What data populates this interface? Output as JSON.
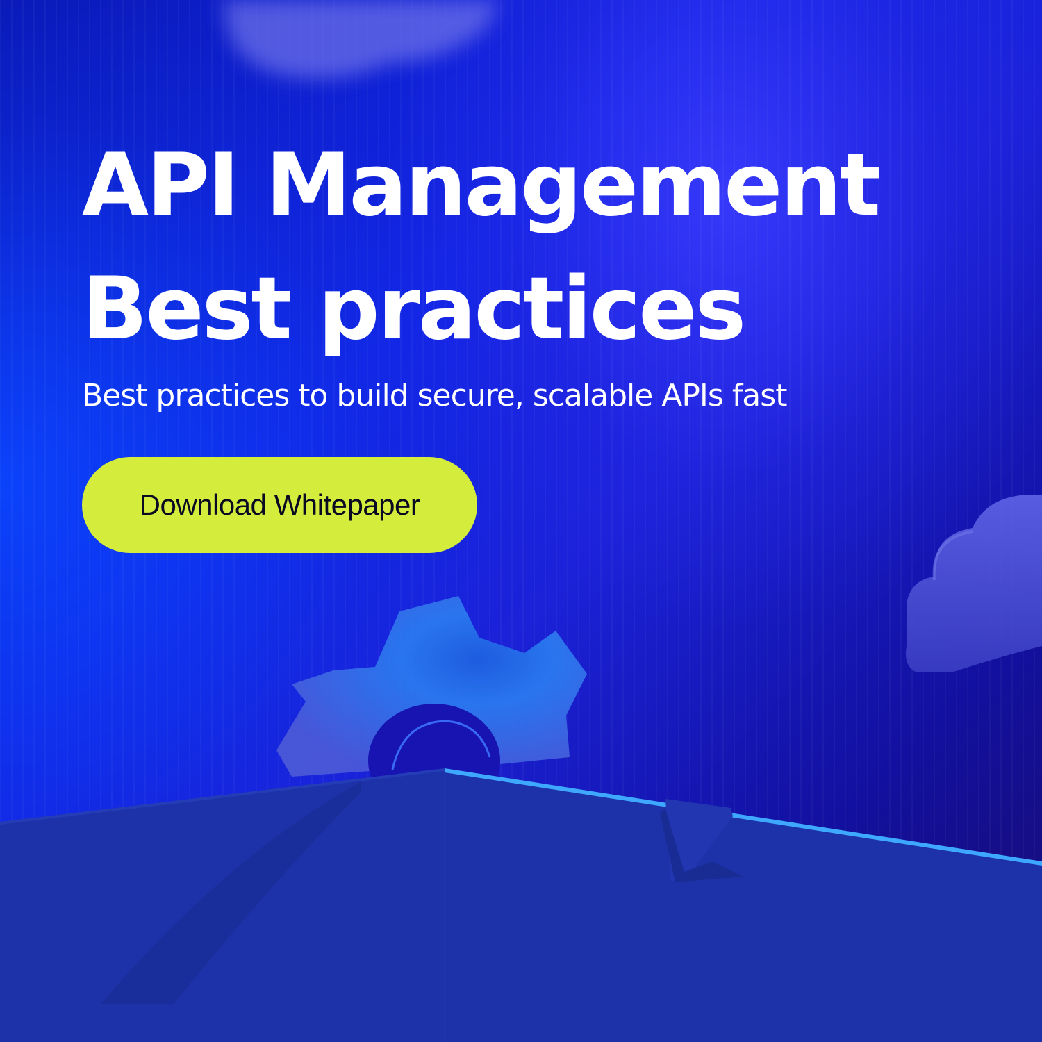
{
  "banner": {
    "headline_line1": "API Management",
    "headline_line2": "Best practices",
    "subtitle": "Best practices to build secure, scalable APIs fast",
    "cta_label": "Download Whitepaper"
  },
  "decorations": {
    "gear": "gear-icon",
    "cloud": "cloud-icon",
    "blurred_shape": "blurred-cloud-shape"
  },
  "colors": {
    "cta_background": "#d4ec3c",
    "cta_text": "#0a0a23",
    "headline_text": "#ffffff",
    "platform": "#1d32a8",
    "platform_edge": "#3ea8ff"
  }
}
